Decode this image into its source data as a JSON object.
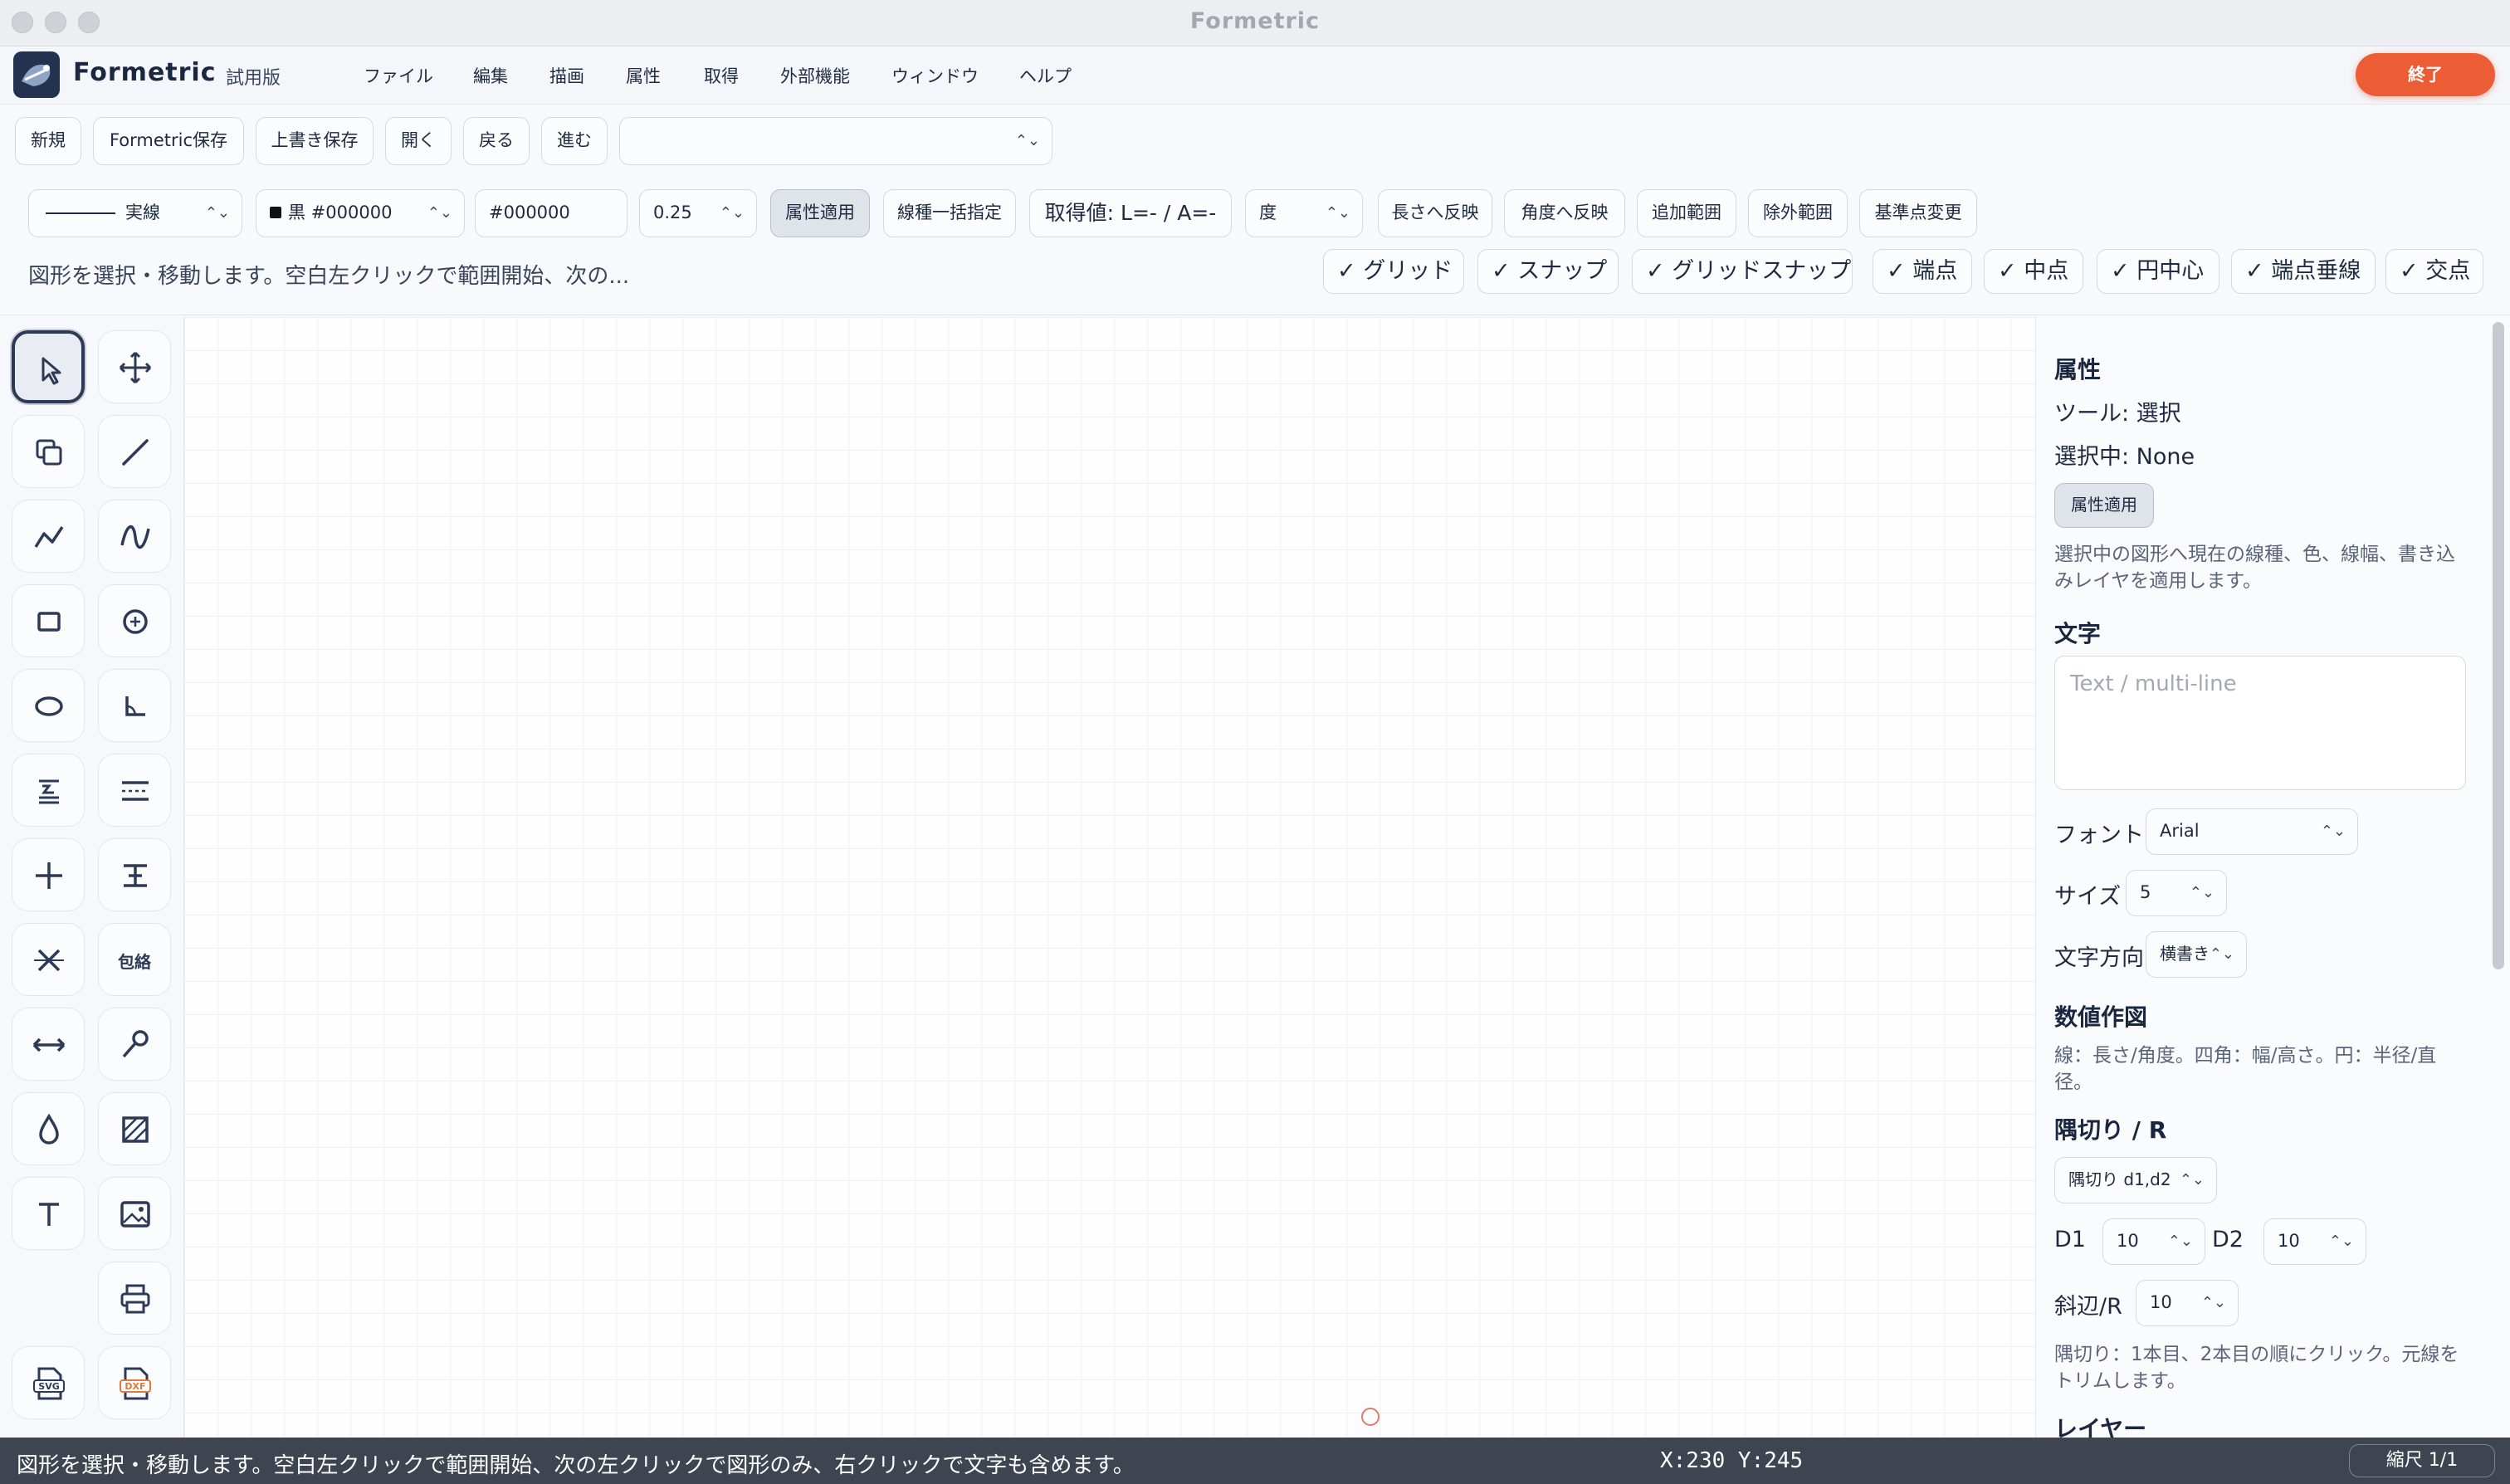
{
  "window": {
    "title": "Formetric"
  },
  "menubar": {
    "app_name": "Formetric",
    "edition": "試用版",
    "menus": [
      "ファイル",
      "編集",
      "描画",
      "属性",
      "取得",
      "外部機能",
      "ウィンドウ",
      "ヘルプ"
    ],
    "exit_label": "終了"
  },
  "toolbar1": {
    "new": "新規",
    "save_formetric": "Formetric保存",
    "overwrite": "上書き保存",
    "open": "開く",
    "undo": "戻る",
    "redo": "進む",
    "file_select_value": ""
  },
  "toolbar2": {
    "line_type": "実線",
    "color_select": "黒 #000000",
    "color_hex": "#000000",
    "line_width": "0.25",
    "apply_attr": "属性適用",
    "bulk_line_type": "線種一括指定",
    "measured_value": "取得値: L=- / A=-",
    "angle_unit": "度",
    "apply_length": "長さへ反映",
    "apply_angle": "角度へ反映",
    "add_range": "追加範囲",
    "exclude_range": "除外範囲",
    "change_base": "基準点変更"
  },
  "hint_text": "図形を選択・移動します。空白左クリックで範囲開始、次の...",
  "snap_toggles": [
    {
      "label": "グリッド",
      "checked": true
    },
    {
      "label": "スナップ",
      "checked": true
    },
    {
      "label": "グリッドスナップ",
      "checked": true
    },
    {
      "label": "端点",
      "checked": true
    },
    {
      "label": "中点",
      "checked": true
    },
    {
      "label": "円中心",
      "checked": true
    },
    {
      "label": "端点垂線",
      "checked": true
    },
    {
      "label": "交点",
      "checked": true
    }
  ],
  "tools": {
    "select": "select-icon",
    "move": "move-icon",
    "copy": "copy-icon",
    "line": "line-icon",
    "polyline": "polyline-icon",
    "curve": "curve-icon",
    "rectangle": "rectangle-icon",
    "circle": "circle-icon",
    "ellipse": "ellipse-icon",
    "angle": "angle-icon",
    "dimension_label": "dimension-icon",
    "parallel": "parallel-lines-icon",
    "cross": "crosshair-icon",
    "align": "align-icon",
    "trim": "trim-icon",
    "envelope_label": "包絡",
    "stretch": "stretch-icon",
    "measure": "measure-icon",
    "fill": "fill-icon",
    "hatch": "hatch-icon",
    "text_tool": "text-icon",
    "image": "image-icon",
    "print": "print-icon",
    "export_svg": "SVG",
    "export_dxf": "DXF"
  },
  "properties": {
    "title": "属性",
    "tool": "ツール: 選択",
    "selection": "選択中: None",
    "apply_button": "属性適用",
    "apply_note": "選択中の図形へ現在の線種、色、線幅、書き込みレイヤを適用します。",
    "text_section": "文字",
    "text_placeholder": "Text / multi-line",
    "font_label": "フォント",
    "font_value": "Arial",
    "size_label": "サイズ",
    "size_value": "5",
    "direction_label": "文字方向",
    "direction_value": "横書き",
    "numeric_section": "数値作図",
    "numeric_note": "線：長さ/角度。四角：幅/高さ。円：半径/直径。",
    "chamfer_section": "隅切り / R",
    "chamfer_mode": "隅切り d1,d2",
    "d1_label": "D1",
    "d1_value": "10",
    "d2_label": "D2",
    "d2_value": "10",
    "slant_label": "斜辺/R",
    "slant_value": "10",
    "chamfer_note": "隅切り：1本目、2本目の順にクリック。元線をトリムします。",
    "layer_section": "レイヤー"
  },
  "statusbar": {
    "message": "図形を選択・移動します。空白左クリックで範囲開始、次の左クリックで図形のみ、右クリックで文字も含めます。",
    "coords": "X:230 Y:245",
    "scale": "縮尺 1/1"
  },
  "colors": {
    "accent": "#2c3a57",
    "exit": "#ec5c35",
    "statusbar": "#3e4450"
  }
}
